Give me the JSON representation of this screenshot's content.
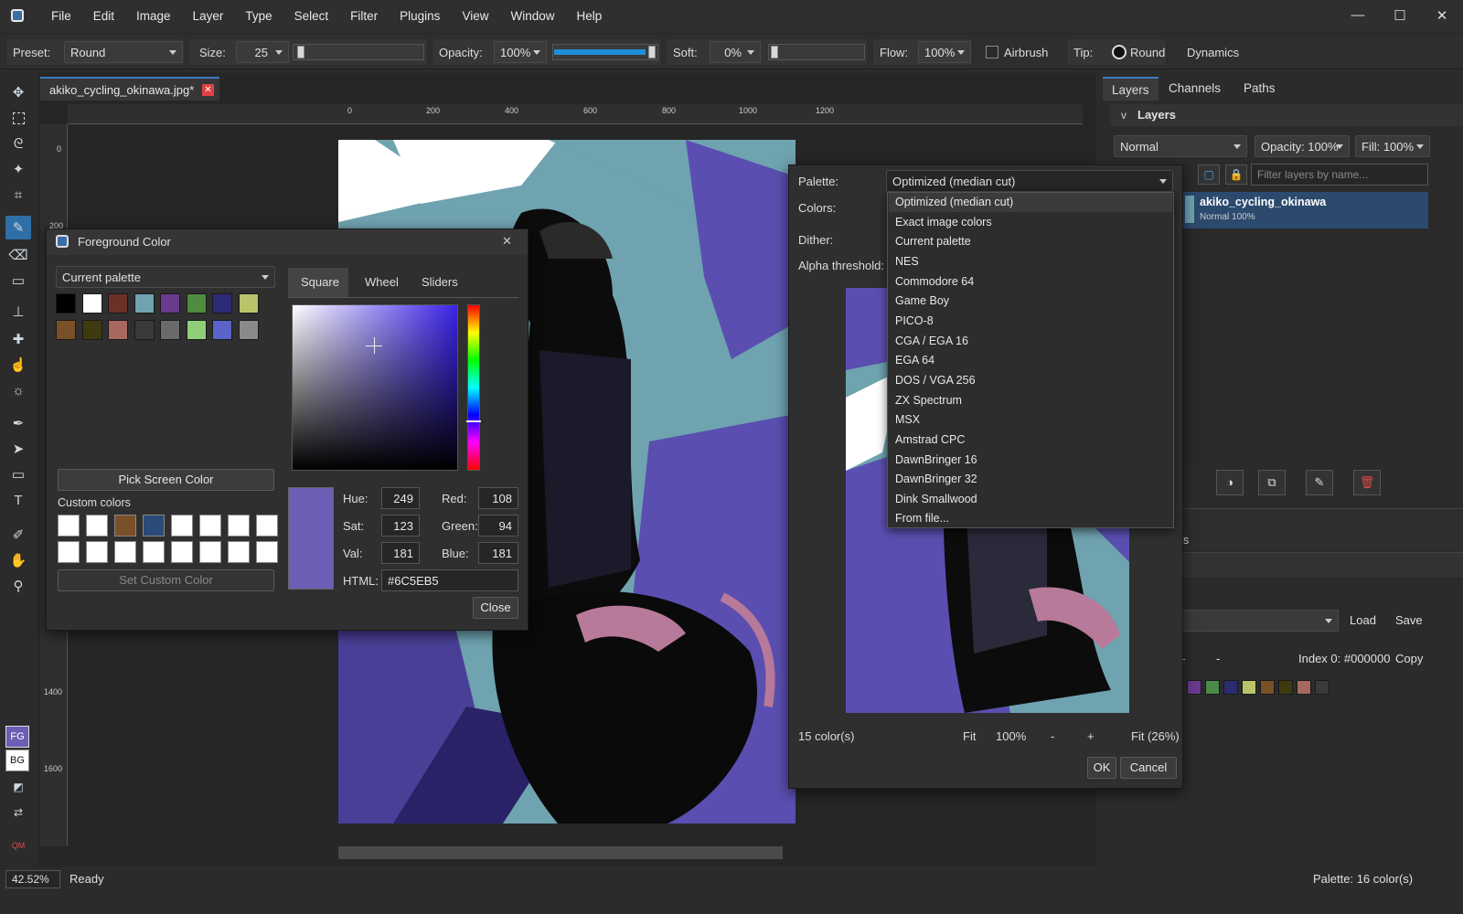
{
  "menubar": {
    "items": [
      "File",
      "Edit",
      "Image",
      "Layer",
      "Type",
      "Select",
      "Filter",
      "Plugins",
      "View",
      "Window",
      "Help"
    ],
    "window_buttons": [
      "—",
      "☐",
      "✕"
    ]
  },
  "options": {
    "preset_label": "Preset:",
    "preset_value": "Round",
    "size_label": "Size:",
    "size_value": "25",
    "opacity_label": "Opacity:",
    "opacity_value": "100%",
    "opacity_level": 1.0,
    "soft_label": "Soft:",
    "soft_value": "0%",
    "flow_label": "Flow:",
    "flow_value": "100%",
    "airbrush_label": "Airbrush",
    "tip_label": "Tip:",
    "tip_value": "Round",
    "dynamics_label": "Dynamics"
  },
  "document": {
    "tab_title": "akiko_cycling_okinawa.jpg*",
    "ruler_top": [
      "0",
      "200",
      "400",
      "600",
      "800",
      "1000",
      "1200"
    ],
    "ruler_left": [
      "0",
      "200",
      "1400",
      "1600"
    ]
  },
  "toolbar": {
    "fg_label": "FG",
    "bg_label": "BG",
    "qm_label": "QM"
  },
  "layers_panel": {
    "tabs": [
      "Layers",
      "Channels",
      "Paths"
    ],
    "section_title": "Layers",
    "section_toggle": "v",
    "blend_mode": "Normal",
    "opacity": "Opacity: 100%",
    "fill": "Fill: 100%",
    "filter_placeholder": "Filter layers by name...",
    "layer_name": "akiko_cycling_okinawa",
    "layer_meta": "Normal  100%",
    "partial_section": "s",
    "load_label": "Load",
    "save_label": "Save",
    "dash1": "-",
    "dash2": "-",
    "index_info": "Index 0: #000000",
    "copy_label": "Copy",
    "palette_swatches": [
      "#6a3a8f",
      "#4a8a4a",
      "#2b2b70",
      "#b9c46a",
      "#7a5028",
      "#3e3a10",
      "#a6685f",
      "#3a3a3a"
    ]
  },
  "status": {
    "zoom": "42.52%",
    "state": "Ready",
    "palette_info": "Palette: 16 color(s)"
  },
  "fg_dialog": {
    "title": "Foreground Color",
    "close_x": "✕",
    "palette_select": "Current palette",
    "palette_swatches": [
      "#000000",
      "#ffffff",
      "#6b3028",
      "#6fa3b0",
      "#6a3a8f",
      "#4e8c40",
      "#2b2b78",
      "#b9c46a",
      "#7a5028",
      "#3e3a10",
      "#a6685f",
      "#3a3a3a",
      "#6a6a6a",
      "#8fcf7a",
      "#5a64c8",
      "#8a8a8a"
    ],
    "tabs": [
      "Square",
      "Wheel",
      "Sliders"
    ],
    "pick_screen": "Pick Screen Color",
    "custom_colors_label": "Custom colors",
    "custom_colors": [
      "#ffffff",
      "#ffffff",
      "#7a5028",
      "#2a4a78",
      "#ffffff",
      "#ffffff",
      "#ffffff",
      "#ffffff",
      "#ffffff",
      "#ffffff",
      "#ffffff",
      "#ffffff",
      "#ffffff",
      "#ffffff",
      "#ffffff",
      "#ffffff"
    ],
    "set_custom": "Set Custom Color",
    "current_color": "#6C5EB5",
    "hue_label": "Hue:",
    "hue": "249",
    "sat_label": "Sat:",
    "sat": "123",
    "val_label": "Val:",
    "val": "181",
    "red_label": "Red:",
    "red": "108",
    "green_label": "Green:",
    "green": "94",
    "blue_label": "Blue:",
    "blue": "181",
    "html_label": "HTML:",
    "html": "#6C5EB5",
    "close_button": "Close"
  },
  "idx_dialog": {
    "palette_label": "Palette:",
    "palette_value": "Optimized (median cut)",
    "colors_label": "Colors:",
    "dither_label": "Dither:",
    "alpha_label": "Alpha threshold:",
    "count": "15 color(s)",
    "fit": "Fit",
    "zoom": "100%",
    "minus": "-",
    "plus": "+",
    "fit_pct": "Fit (26%)",
    "ok": "OK",
    "cancel": "Cancel",
    "options": [
      "Optimized (median cut)",
      "Exact image colors",
      "Current palette",
      "NES",
      "Commodore 64",
      "Game Boy",
      "PICO-8",
      "CGA / EGA 16",
      "EGA 64",
      "DOS / VGA 256",
      "ZX Spectrum",
      "MSX",
      "Amstrad CPC",
      "DawnBringer 16",
      "DawnBringer 32",
      "Dink Smallwood",
      "From file..."
    ],
    "selected_option": 0
  }
}
